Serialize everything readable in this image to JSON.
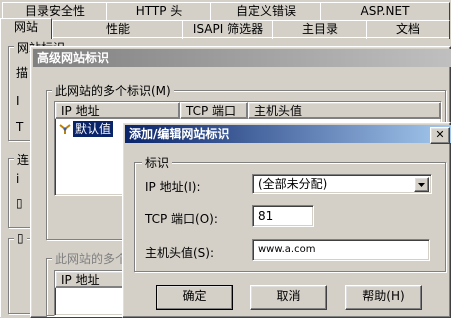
{
  "props_tabs_row1": [
    "目录安全性",
    "HTTP 头",
    "自定义错误",
    "ASP.NET"
  ],
  "props_tabs_row2": [
    "网站",
    "性能",
    "ISAPI 筛选器",
    "主目录",
    "文档"
  ],
  "props_fragments": {
    "group1_title": "网站标识",
    "side_a": "描",
    "side_b": "I",
    "side_c": "T",
    "group2_title": "连",
    "side_d": "i",
    "side_e": "▯",
    "group3_title": "▯"
  },
  "advanced": {
    "title": "高级网站标识",
    "group_title": "此网站的多个标识(M)",
    "columns": [
      "IP 地址",
      "TCP 端口",
      "主机头值"
    ],
    "rows": [
      {
        "ip": "默认值",
        "port": "",
        "host": ""
      }
    ],
    "group2_title": "此网站的多个",
    "columns2": [
      "IP 地址"
    ]
  },
  "edit": {
    "title": "添加/编辑网站标识",
    "close_glyph": "✕",
    "group_title": "标识",
    "ip_label": "IP 地址(I):",
    "ip_value": "(全部未分配)",
    "port_label": "TCP 端口(O):",
    "port_value": "81",
    "host_label": "主机头值(S):",
    "host_value": "www.a.com",
    "ok": "确定",
    "cancel": "取消",
    "help": "帮助(H)"
  },
  "colors": {
    "titlebar_from": "#0a246a",
    "titlebar_to": "#a6caf0",
    "inactive_from": "#808080",
    "inactive_to": "#c0c0c0"
  },
  "icons": [
    "dropdown-arrow-icon",
    "close-icon",
    "identity-icon"
  ]
}
